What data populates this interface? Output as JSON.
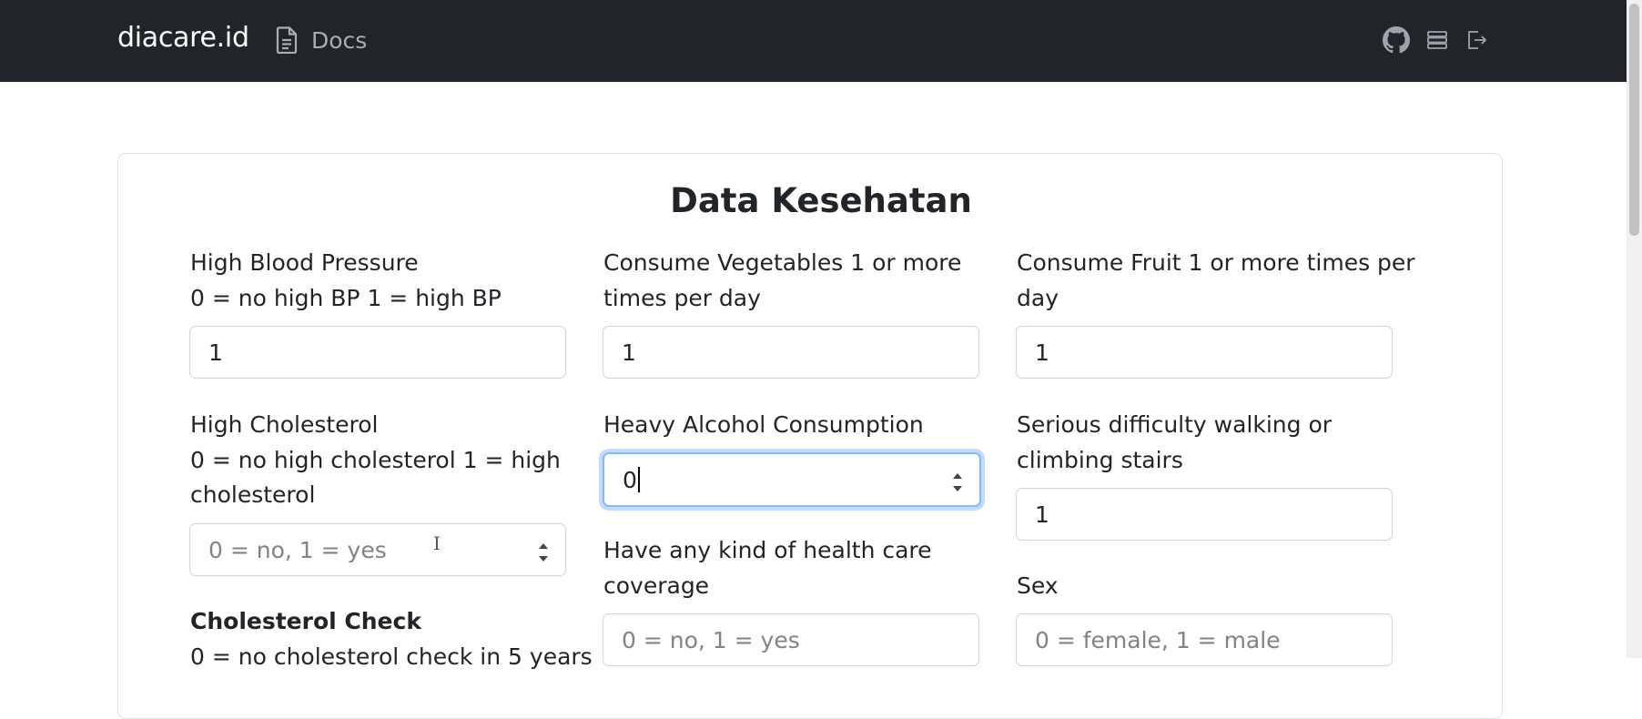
{
  "nav": {
    "brand": "diacare.id",
    "docs_label": "Docs",
    "icons": [
      "github-icon",
      "server-icon",
      "logout-icon"
    ]
  },
  "form": {
    "title": "Data Kesehatan",
    "fields": {
      "high_bp": {
        "label_1": "High Blood Pressure",
        "label_2": "0 = no high BP 1 = high BP",
        "value": "1"
      },
      "veggies": {
        "label_1": "Consume Vegetables 1 or more",
        "label_2": "times per day",
        "value": "1"
      },
      "fruit": {
        "label_1": "Consume Fruit 1 or more times per",
        "label_2": "day",
        "value": "1"
      },
      "high_chol": {
        "label_1": "High Cholesterol",
        "label_2": "0 = no high cholesterol 1 = high",
        "label_3": "cholesterol",
        "placeholder": "0 = no, 1 = yes"
      },
      "alcohol": {
        "label_1": "Heavy Alcohol Consumption",
        "value": "0"
      },
      "diff_walk": {
        "label_1": "Serious difficulty walking or",
        "label_2": "climbing stairs",
        "value": "1"
      },
      "healthcare": {
        "label_1": "Have any kind of health care",
        "label_2": "coverage",
        "placeholder": "0 = no, 1 = yes"
      },
      "sex": {
        "label_1": "Sex",
        "placeholder": "0 = female, 1 = male"
      },
      "chol_check": {
        "label_1": "Cholesterol Check",
        "label_2": "0 = no cholesterol check in 5 years"
      }
    }
  }
}
